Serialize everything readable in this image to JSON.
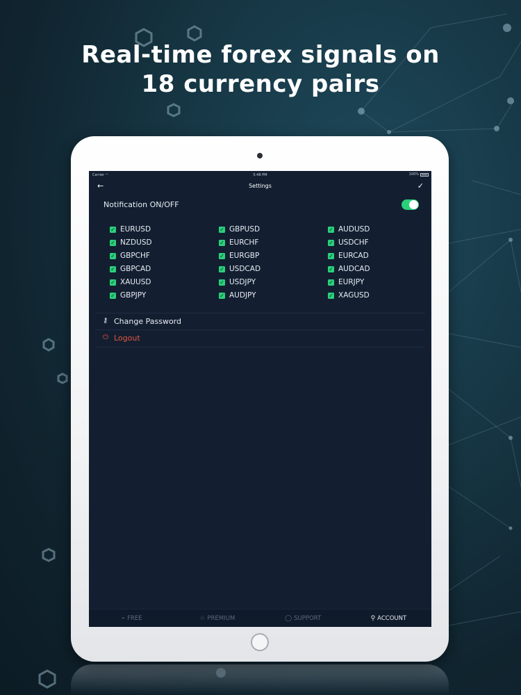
{
  "headline": {
    "line1": "Real-time forex signals on",
    "line2": "18 currency pairs"
  },
  "status_bar": {
    "carrier": "Carrier",
    "time": "5:48 PM",
    "battery": "100%"
  },
  "nav": {
    "back_icon": "arrow-left-icon",
    "title": "Settings",
    "done_icon": "checkmark-icon"
  },
  "notification": {
    "label": "Notification ON/OFF",
    "enabled": true
  },
  "pairs": [
    {
      "label": "EURUSD",
      "checked": true
    },
    {
      "label": "GBPUSD",
      "checked": true
    },
    {
      "label": "AUDUSD",
      "checked": true
    },
    {
      "label": "NZDUSD",
      "checked": true
    },
    {
      "label": "EURCHF",
      "checked": true
    },
    {
      "label": "USDCHF",
      "checked": true
    },
    {
      "label": "GBPCHF",
      "checked": true
    },
    {
      "label": "EURGBP",
      "checked": true
    },
    {
      "label": "EURCAD",
      "checked": true
    },
    {
      "label": "GBPCAD",
      "checked": true
    },
    {
      "label": "USDCAD",
      "checked": true
    },
    {
      "label": "AUDCAD",
      "checked": true
    },
    {
      "label": "XAUUSD",
      "checked": true
    },
    {
      "label": "USDJPY",
      "checked": true
    },
    {
      "label": "EURJPY",
      "checked": true
    },
    {
      "label": "GBPJPY",
      "checked": true
    },
    {
      "label": "AUDJPY",
      "checked": true
    },
    {
      "label": "XAGUSD",
      "checked": true
    }
  ],
  "menu": {
    "change_password": "Change Password",
    "logout": "Logout"
  },
  "tabs": [
    {
      "label": "FREE",
      "icon": "pulse-icon",
      "active": false
    },
    {
      "label": "PREMIUM",
      "icon": "star-icon",
      "active": false
    },
    {
      "label": "SUPPORT",
      "icon": "chat-bubble-icon",
      "active": false
    },
    {
      "label": "ACCOUNT",
      "icon": "user-icon",
      "active": true
    }
  ],
  "colors": {
    "accent_green": "#2bd07b",
    "logout_red": "#e0553f",
    "screen_bg": "#131f31"
  }
}
